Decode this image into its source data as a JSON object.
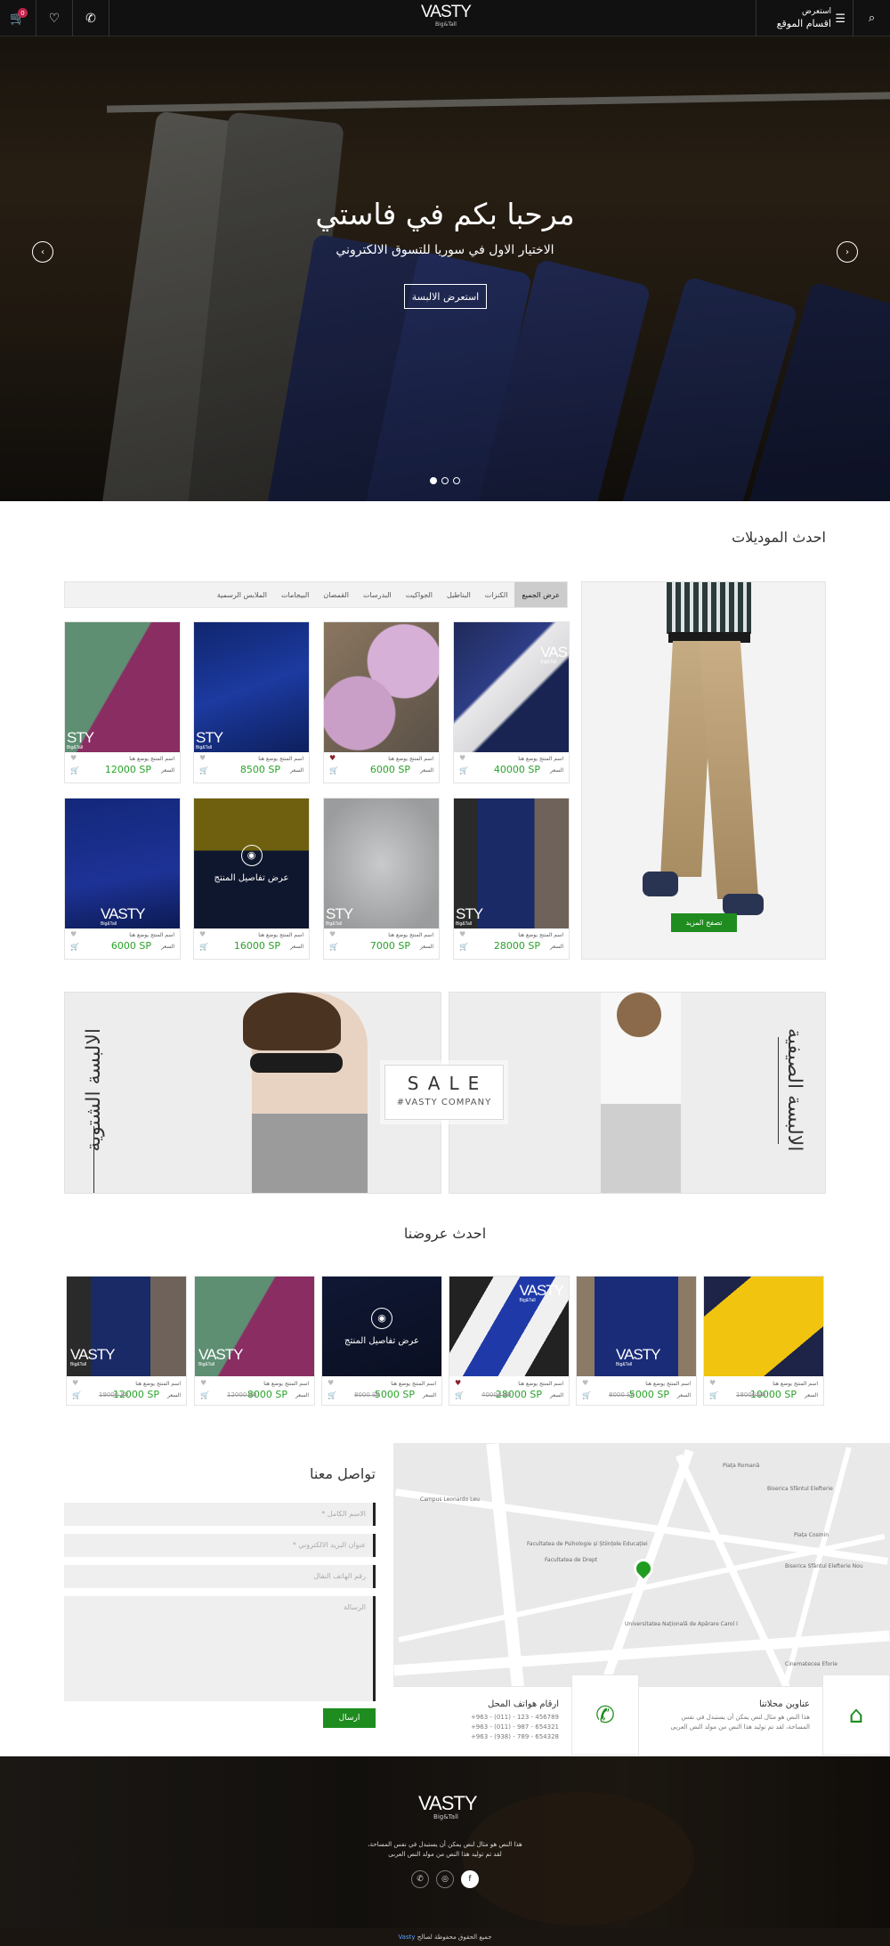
{
  "header": {
    "logo_main": "VASTY",
    "logo_sub": "Big&Tall",
    "menu_small": "استعرض",
    "menu_large": "اقسام الموقع",
    "cart_count": "0"
  },
  "hero": {
    "title": "مرحبا بكم في فاستي",
    "subtitle": "الاختيار الاول في سوريا للتسوق الالكتروني",
    "button": "استعرض الالبسة",
    "slides": 3,
    "active_slide": 1
  },
  "models": {
    "title": "احدث الموديلات",
    "tabs": [
      "عرض الجميع",
      "الكنزات",
      "البناطيل",
      "الجواكيت",
      "البدرسات",
      "القمصان",
      "البيجامات",
      "الملابس الرسمية"
    ],
    "more_button": "تصفح المزيد",
    "name_text": "اسم المنتج يوضع هنا",
    "price_label": "السعر",
    "details_label": "عرض تفاصيل المنتج",
    "products": [
      {
        "price": "40000 SP",
        "liked": false
      },
      {
        "price": "6000 SP",
        "liked": true
      },
      {
        "price": "8500 SP",
        "liked": false
      },
      {
        "price": "12000 SP",
        "liked": false
      },
      {
        "price": "28000 SP",
        "liked": false,
        "in_cart": true
      },
      {
        "price": "7000 SP",
        "liked": false
      },
      {
        "price": "16000 SP",
        "liked": false
      },
      {
        "price": "6000 SP",
        "liked": false
      }
    ]
  },
  "banners": {
    "summer": "الالبسة الصيفية",
    "winter": "الالبسة الشتوية",
    "sale": "SALE",
    "company": "#VASTY COMPANY"
  },
  "offers": {
    "title": "احدث عروضنا",
    "items": [
      {
        "price": "10000 SP",
        "old": "18000 SP"
      },
      {
        "price": "5000 SP",
        "old": "8000 SP"
      },
      {
        "price": "28000 SP",
        "old": "40000 SP",
        "liked": true
      },
      {
        "price": "5000 SP",
        "old": "8000 SP"
      },
      {
        "price": "8000 SP",
        "old": "12000 SP"
      },
      {
        "price": "12000 SP",
        "old": "19000 SP"
      }
    ]
  },
  "contact": {
    "title": "تواصل معنا",
    "name_ph": "الاسم الكامل *",
    "email_ph": "عنوان البريد الالكتروني *",
    "phone_ph": "رقم الهاتف النقال",
    "message_ph": "الرسالة",
    "send": "ارسال"
  },
  "info": {
    "address_title": "عناوين محلاتنا",
    "address_text_1": "هذا النص هو مثال لنص يمكن أن يستبدل في نفس",
    "address_text_2": "المساحة، لقد تم توليد هذا النص من مولد النص العربى",
    "phones_title": "ارقام هواتف المحل",
    "phones": [
      "+963 - (011) - 123 - 456789",
      "+963 - (011) - 987 - 654321",
      "+963 - (938) - 789 - 654328"
    ]
  },
  "map_labels": [
    "Campus Leonardo Leu",
    "Facultatea de Psihologie și Științele Educației",
    "Facultatea de Drept",
    "Universitatea Națională de Apărare Carol I",
    "Piața Romană",
    "Piața Cosmin",
    "Biserica Sfântul Elefterie",
    "Cinematecea Eforie",
    "Biserica Sfântul Elefterie Nou"
  ],
  "footer": {
    "logo_main": "VASTY",
    "logo_sub": "Big&Tall",
    "text_1": "هذا النص هو مثال لنص يمكن أن يستبدل في نفس المساحة،",
    "text_2": "لقد تم توليد هذا النص من مولد النص العربى",
    "copyright": "جميع الحقوق محفوظة لصالح",
    "brand": "Vasty"
  },
  "colors": {
    "accent": "#1f8c1f",
    "price": "#2aa32a",
    "badge": "#c3234a"
  }
}
